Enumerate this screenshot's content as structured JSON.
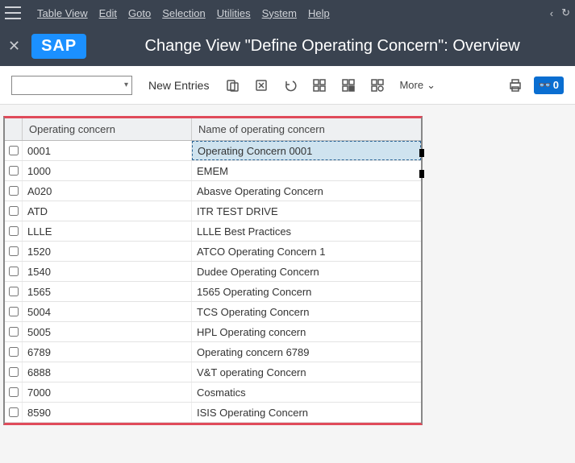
{
  "menubar": {
    "items": [
      "Table View",
      "Edit",
      "Goto",
      "Selection",
      "Utilities",
      "System",
      "Help"
    ]
  },
  "titlebar": {
    "logo": "SAP",
    "page_title": "Change View \"Define Operating Concern\": Overview"
  },
  "toolbar": {
    "command_value": "",
    "new_entries": "New Entries",
    "more": "More",
    "badge_text": "0"
  },
  "grid": {
    "col_code": "Operating concern",
    "col_name": "Name of operating concern",
    "rows": [
      {
        "code": "0001",
        "name": "Operating Concern 0001",
        "selected": true
      },
      {
        "code": "1000",
        "name": "EMEM",
        "selected": false
      },
      {
        "code": "A020",
        "name": "Abasve Operating Concern",
        "selected": false
      },
      {
        "code": "ATD",
        "name": "ITR TEST DRIVE",
        "selected": false
      },
      {
        "code": "LLLE",
        "name": "LLLE Best Practices",
        "selected": false
      },
      {
        "code": "1520",
        "name": "ATCO Operating Concern 1",
        "selected": false
      },
      {
        "code": "1540",
        "name": "Dudee Operating Concern",
        "selected": false
      },
      {
        "code": "1565",
        "name": "1565 Operating Concern",
        "selected": false
      },
      {
        "code": "5004",
        "name": "TCS Operating Concern",
        "selected": false
      },
      {
        "code": "5005",
        "name": "HPL Operating concern",
        "selected": false
      },
      {
        "code": "6789",
        "name": "Operating concern 6789",
        "selected": false
      },
      {
        "code": "6888",
        "name": "V&T operating Concern",
        "selected": false
      },
      {
        "code": "7000",
        "name": "Cosmatics",
        "selected": false
      },
      {
        "code": "8590",
        "name": "ISIS Operating Concern",
        "selected": false
      }
    ]
  }
}
